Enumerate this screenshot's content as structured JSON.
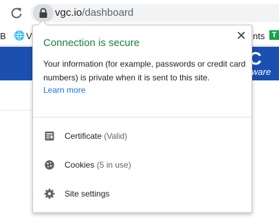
{
  "browser": {
    "url_host": "vgc.io",
    "url_path": "/dashboard"
  },
  "bookmarks": {
    "first_initial": "B",
    "second_initial": "V",
    "right_fragment": "nts"
  },
  "page": {
    "brand_big": "C",
    "brand_small": "ware"
  },
  "popup": {
    "title": "Connection is secure",
    "description": "Your information (for example, passwords or credit card numbers) is private when it is sent to this site.",
    "learn_more": "Learn more",
    "close_glyph": "✕",
    "items": [
      {
        "label": "Certificate",
        "sub": "(Valid)",
        "icon": "certificate-icon"
      },
      {
        "label": "Cookies",
        "sub": "(5 in use)",
        "icon": "cookie-icon"
      },
      {
        "label": "Site settings",
        "sub": "",
        "icon": "gear-icon"
      }
    ]
  },
  "colors": {
    "secure_green": "#188038",
    "link_blue": "#1a73e8",
    "banner_blue": "#1b4fb0"
  }
}
